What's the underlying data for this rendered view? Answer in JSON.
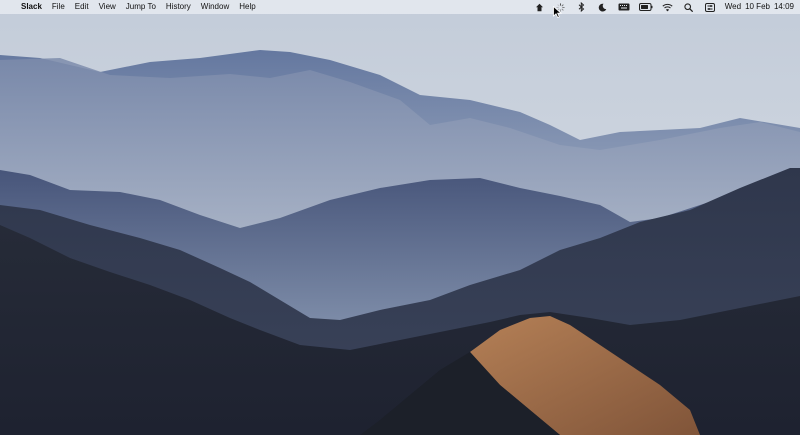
{
  "menubar": {
    "apple_icon": "apple-logo-icon",
    "app_name": "Slack",
    "menus": [
      "File",
      "Edit",
      "View",
      "Jump To",
      "History",
      "Window",
      "Help"
    ],
    "status_icons": [
      "slack-status-icon",
      "sync-spinner-icon",
      "bluetooth-icon",
      "do-not-disturb-moon-icon",
      "keyboard-input-icon",
      "battery-icon",
      "wifi-icon",
      "spotlight-search-icon",
      "control-center-icon"
    ],
    "clock": {
      "day": "Wed",
      "date": "10 Feb",
      "time": "14:09"
    }
  },
  "wallpaper": {
    "description_icon": "mountain-landscape-wallpaper",
    "colors": {
      "sky": "#c9d2de",
      "far_ridge": "#6f80a6",
      "mid_ridge": "#4a5878",
      "near_ridge": "#2b3040",
      "sunlit_slope": "#b57a4e"
    }
  }
}
